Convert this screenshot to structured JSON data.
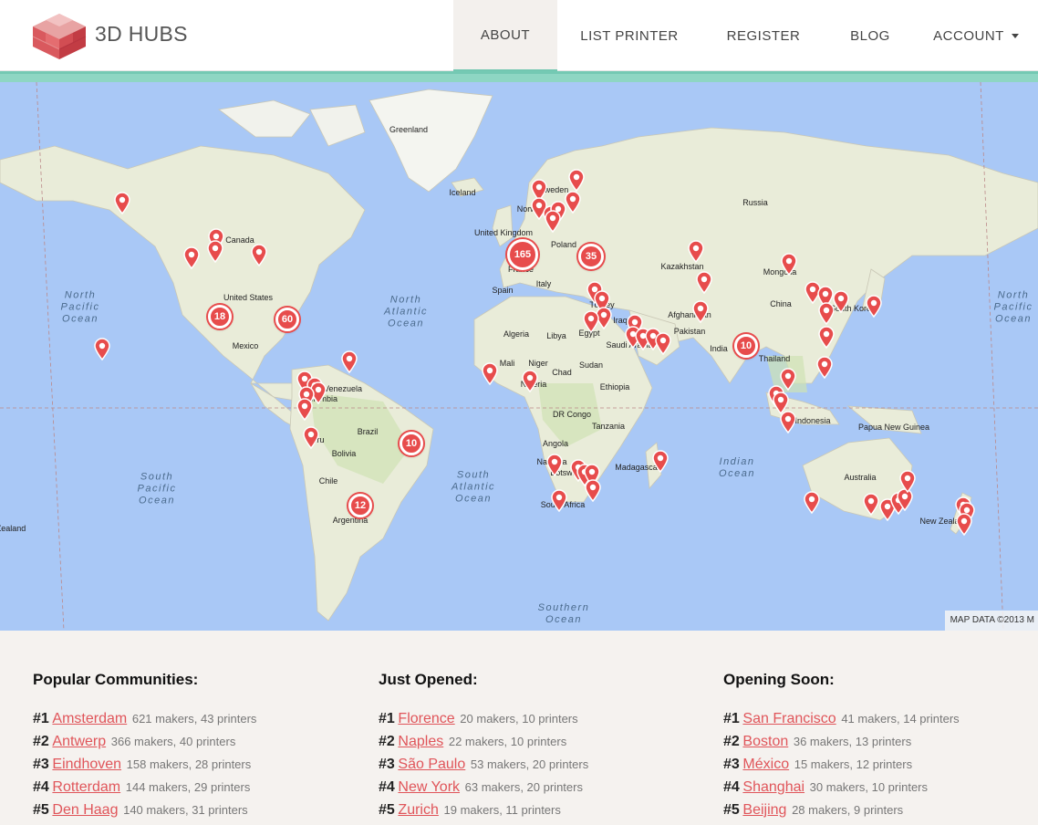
{
  "header": {
    "brand": "3D HUBS",
    "nav": [
      {
        "label": "ABOUT",
        "active": true
      },
      {
        "label": "LIST PRINTER"
      },
      {
        "label": "REGISTER"
      },
      {
        "label": "BLOG"
      },
      {
        "label": "ACCOUNT",
        "dropdown": true
      }
    ]
  },
  "map": {
    "attribution": "MAP DATA ©2013 M",
    "labels": [
      "Greenland",
      "Iceland",
      "Sweden",
      "Norway",
      "United Kingdom",
      "Poland",
      "Spain",
      "France",
      "Italy",
      "Russia",
      "Kazakhstan",
      "Mongolia",
      "China",
      "South Korea",
      "Afghanistan",
      "Pakistan",
      "India",
      "Thailand",
      "Iraq",
      "Saudi Arabia",
      "Egypt",
      "Libya",
      "Algeria",
      "Mali",
      "Niger",
      "Chad",
      "Sudan",
      "Nigeria",
      "Ethiopia",
      "DR Congo",
      "Tanzania",
      "Angola",
      "Namibia",
      "Botswana",
      "South Africa",
      "Madagascar",
      "Indonesia",
      "Papua New Guinea",
      "Australia",
      "New Zealand",
      "Canada",
      "United States",
      "Mexico",
      "Venezuela",
      "Colombia",
      "Peru",
      "Brazil",
      "Bolivia",
      "Chile",
      "Argentina",
      "Zealand",
      "Turkey"
    ],
    "oceans": [
      "North\nPacific\nOcean",
      "North\nAtlantic\nOcean",
      "South\nPacific\nOcean",
      "South\nAtlantic\nOcean",
      "Indian\nOcean",
      "Southern\nOcean",
      "North\nPacific\nOcean"
    ],
    "clusters": [
      "165",
      "35",
      "18",
      "60",
      "10",
      "10",
      "12"
    ],
    "marker_color": "#e74c4c"
  },
  "lists": [
    {
      "title": "Popular Communities:",
      "items": [
        {
          "rank": "#1",
          "city": "Amsterdam",
          "stats": "621 makers, 43 printers"
        },
        {
          "rank": "#2",
          "city": "Antwerp",
          "stats": "366 makers, 40 printers"
        },
        {
          "rank": "#3",
          "city": "Eindhoven",
          "stats": "158 makers, 28 printers"
        },
        {
          "rank": "#4",
          "city": "Rotterdam",
          "stats": "144 makers, 29 printers"
        },
        {
          "rank": "#5",
          "city": "Den Haag",
          "stats": "140 makers, 31 printers"
        }
      ]
    },
    {
      "title": "Just Opened:",
      "items": [
        {
          "rank": "#1",
          "city": "Florence",
          "stats": "20 makers, 10 printers"
        },
        {
          "rank": "#2",
          "city": "Naples",
          "stats": "22 makers, 10 printers"
        },
        {
          "rank": "#3",
          "city": "São Paulo",
          "stats": "53 makers, 20 printers"
        },
        {
          "rank": "#4",
          "city": "New York",
          "stats": "63 makers, 20 printers"
        },
        {
          "rank": "#5",
          "city": "Zurich",
          "stats": "19 makers, 11 printers"
        }
      ]
    },
    {
      "title": "Opening Soon:",
      "items": [
        {
          "rank": "#1",
          "city": "San Francisco",
          "stats": "41 makers, 14 printers"
        },
        {
          "rank": "#2",
          "city": "Boston",
          "stats": "36 makers, 13 printers"
        },
        {
          "rank": "#3",
          "city": "México",
          "stats": "15 makers, 12 printers"
        },
        {
          "rank": "#4",
          "city": "Shanghai",
          "stats": "30 makers, 10 printers"
        },
        {
          "rank": "#5",
          "city": "Beijing",
          "stats": "28 makers, 9 printers"
        }
      ]
    }
  ]
}
